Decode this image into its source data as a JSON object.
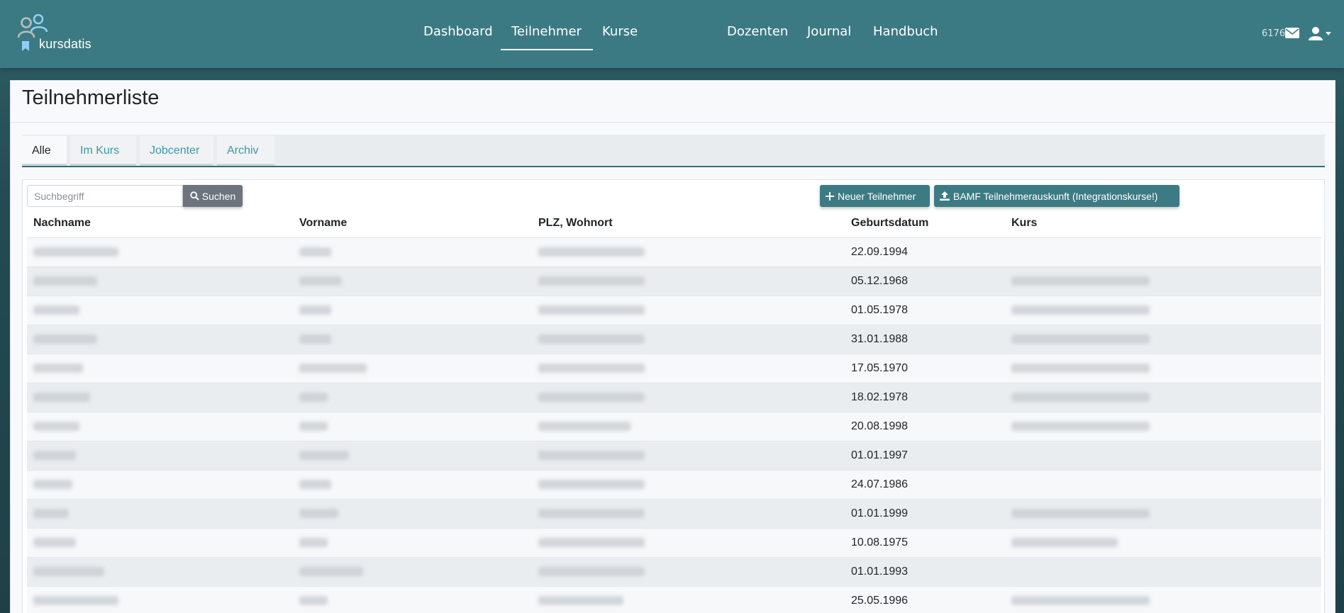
{
  "brand": {
    "name": "kursdatis"
  },
  "nav": {
    "items": [
      {
        "label": "Dashboard",
        "active": false
      },
      {
        "label": "Teilnehmer",
        "active": true
      },
      {
        "label": "Kurse",
        "active": false
      },
      {
        "label": "Dozenten",
        "active": false
      },
      {
        "label": "Journal",
        "active": false
      },
      {
        "label": "Handbuch",
        "active": false
      }
    ],
    "mail_count": "6176",
    "icons": [
      "envelope-icon",
      "user-icon",
      "caret-down-icon"
    ]
  },
  "page": {
    "title": "Teilnehmerliste"
  },
  "tabs": [
    {
      "label": "Alle",
      "active": true
    },
    {
      "label": "Im Kurs",
      "active": false
    },
    {
      "label": "Jobcenter",
      "active": false
    },
    {
      "label": "Archiv",
      "active": false
    }
  ],
  "toolbar": {
    "search_placeholder": "Suchbegriff",
    "search_label": "Suchen",
    "new_label": "Neuer Teilnehmer",
    "bamf_label": "BAMF Teilnehmerauskunft (Integrationskurse!)"
  },
  "table": {
    "columns": [
      "Nachname",
      "Vorname",
      "PLZ, Wohnort",
      "Geburtsdatum",
      "Kurs"
    ],
    "rows": [
      {
        "geburtsdatum": "22.09.1994",
        "kurs_visible": false
      },
      {
        "geburtsdatum": "05.12.1968",
        "kurs_visible": true
      },
      {
        "geburtsdatum": "01.05.1978",
        "kurs_visible": true
      },
      {
        "geburtsdatum": "31.01.1988",
        "kurs_visible": true
      },
      {
        "geburtsdatum": "17.05.1970",
        "kurs_visible": true
      },
      {
        "geburtsdatum": "18.02.1978",
        "kurs_visible": true
      },
      {
        "geburtsdatum": "20.08.1998",
        "kurs_visible": true
      },
      {
        "geburtsdatum": "01.01.1997",
        "kurs_visible": false
      },
      {
        "geburtsdatum": "24.07.1986",
        "kurs_visible": false
      },
      {
        "geburtsdatum": "01.01.1999",
        "kurs_visible": true
      },
      {
        "geburtsdatum": "10.08.1975",
        "kurs_visible": true
      },
      {
        "geburtsdatum": "01.01.1993",
        "kurs_visible": false
      },
      {
        "geburtsdatum": "25.05.1996",
        "kurs_visible": true
      }
    ]
  },
  "colors": {
    "navbar": "#3c7a83",
    "accent": "#3a9aa6",
    "button_teal": "#3d7b84",
    "button_gray": "#6c757d"
  }
}
